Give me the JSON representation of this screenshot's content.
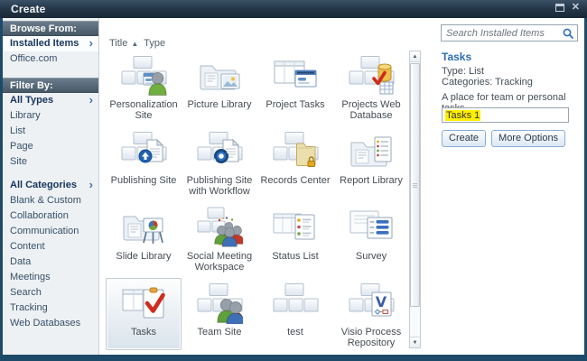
{
  "window": {
    "title": "Create"
  },
  "sidebar": {
    "browse_from_header": "Browse From:",
    "browse_items": [
      {
        "label": "Installed Items",
        "selected": true
      },
      {
        "label": "Office.com",
        "selected": false
      }
    ],
    "filter_by_header": "Filter By:",
    "type_filters": [
      {
        "label": "All Types",
        "selected": true
      },
      {
        "label": "Library"
      },
      {
        "label": "List"
      },
      {
        "label": "Page"
      },
      {
        "label": "Site"
      }
    ],
    "category_filters": [
      {
        "label": "All Categories",
        "selected": true
      },
      {
        "label": "Blank & Custom"
      },
      {
        "label": "Collaboration"
      },
      {
        "label": "Communication"
      },
      {
        "label": "Content"
      },
      {
        "label": "Data"
      },
      {
        "label": "Meetings"
      },
      {
        "label": "Search"
      },
      {
        "label": "Tracking"
      },
      {
        "label": "Web Databases"
      }
    ]
  },
  "sort_bar": {
    "title_label": "Title",
    "sort_arrow": "▲",
    "type_label": "Type"
  },
  "grid": {
    "items": [
      {
        "label": "Personalization Site",
        "icon": "personalization-site-icon"
      },
      {
        "label": "Picture Library",
        "icon": "picture-library-icon"
      },
      {
        "label": "Project Tasks",
        "icon": "project-tasks-icon"
      },
      {
        "label": "Projects Web Database",
        "icon": "projects-web-database-icon"
      },
      {
        "label": "Publishing Site",
        "icon": "publishing-site-icon"
      },
      {
        "label": "Publishing Site with Workflow",
        "icon": "publishing-site-workflow-icon"
      },
      {
        "label": "Records Center",
        "icon": "records-center-icon"
      },
      {
        "label": "Report Library",
        "icon": "report-library-icon"
      },
      {
        "label": "Slide Library",
        "icon": "slide-library-icon"
      },
      {
        "label": "Social Meeting Workspace",
        "icon": "social-meeting-workspace-icon"
      },
      {
        "label": "Status List",
        "icon": "status-list-icon"
      },
      {
        "label": "Survey",
        "icon": "survey-icon"
      },
      {
        "label": "Tasks",
        "icon": "tasks-icon",
        "selected": true
      },
      {
        "label": "Team Site",
        "icon": "team-site-icon"
      },
      {
        "label": "test",
        "icon": "site-boxes-icon"
      },
      {
        "label": "Visio Process Repository",
        "icon": "visio-process-repository-icon"
      }
    ]
  },
  "search": {
    "placeholder": "Search Installed Items"
  },
  "details": {
    "title": "Tasks",
    "type_label": "Type: List",
    "categories_label": "Categories: Tracking",
    "description": "A place for team or personal tasks.",
    "name_input_value": "Tasks 1",
    "create_button": "Create",
    "more_options_button": "More Options"
  },
  "colors": {
    "titlebar": "#25384a",
    "dialog_border": "#1c4a68",
    "sidebar_header": "#475866",
    "link_text": "#35506b",
    "selected_link": "#17355e",
    "panel_heading": "#2b6cb5",
    "input_highlight": "#ffee00",
    "button_border": "#89aed3"
  }
}
